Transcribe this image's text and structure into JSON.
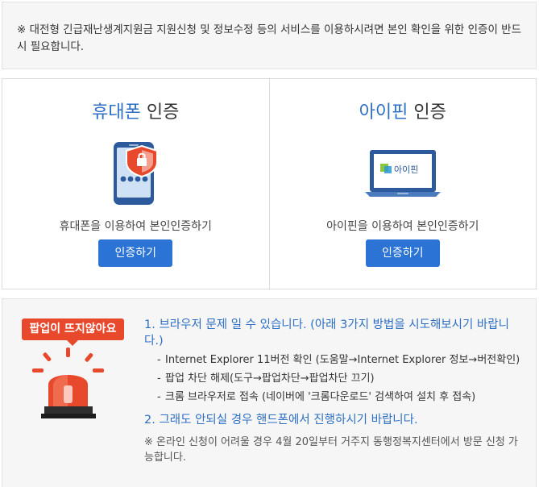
{
  "notice": {
    "text": "※ 대전형 긴급재난생계지원금 지원신청 및 정보수정 등의 서비스를 이용하시려면 본인 확인을 위한 인증이 반드시 필요합니다."
  },
  "phone_card": {
    "title_highlight": "휴대폰",
    "title_rest": " 인증",
    "desc": "휴대폰을 이용하여 본인인증하기",
    "button": "인증하기"
  },
  "ipin_card": {
    "title_highlight": "아이핀",
    "title_rest": " 인증",
    "logo_text": "아이핀",
    "desc": "아이핀을 이용하여 본인인증하기",
    "button": "인증하기"
  },
  "help": {
    "badge": "팝업이 뜨지않아요",
    "heading1": "1. 브라우저 문제 일 수 있습니다. (아래 3가지 방법을 시도해보시기 바랍니다.)",
    "items": [
      "Internet Explorer 11버전 확인 (도움말→Internet Explorer 정보→버전확인)",
      "팝업 차단 해제(도구→팝업차단→팝업차단 끄기)",
      "크롬 브라우저로 접속 (네이버에 '크롬다운로드' 검색하여 설치 후 접속)"
    ],
    "heading2": "2. 그래도 안되실 경우 핸드폰에서 진행하시기 바랍니다.",
    "note": "※ 온라인 신청이 어려울 경우 4월 20일부터 거주지 동행정복지센터에서 방문 신청 가능합니다."
  },
  "colors": {
    "accent": "#2c6fc4",
    "button": "#2b73d4",
    "badge": "#e8492c"
  }
}
